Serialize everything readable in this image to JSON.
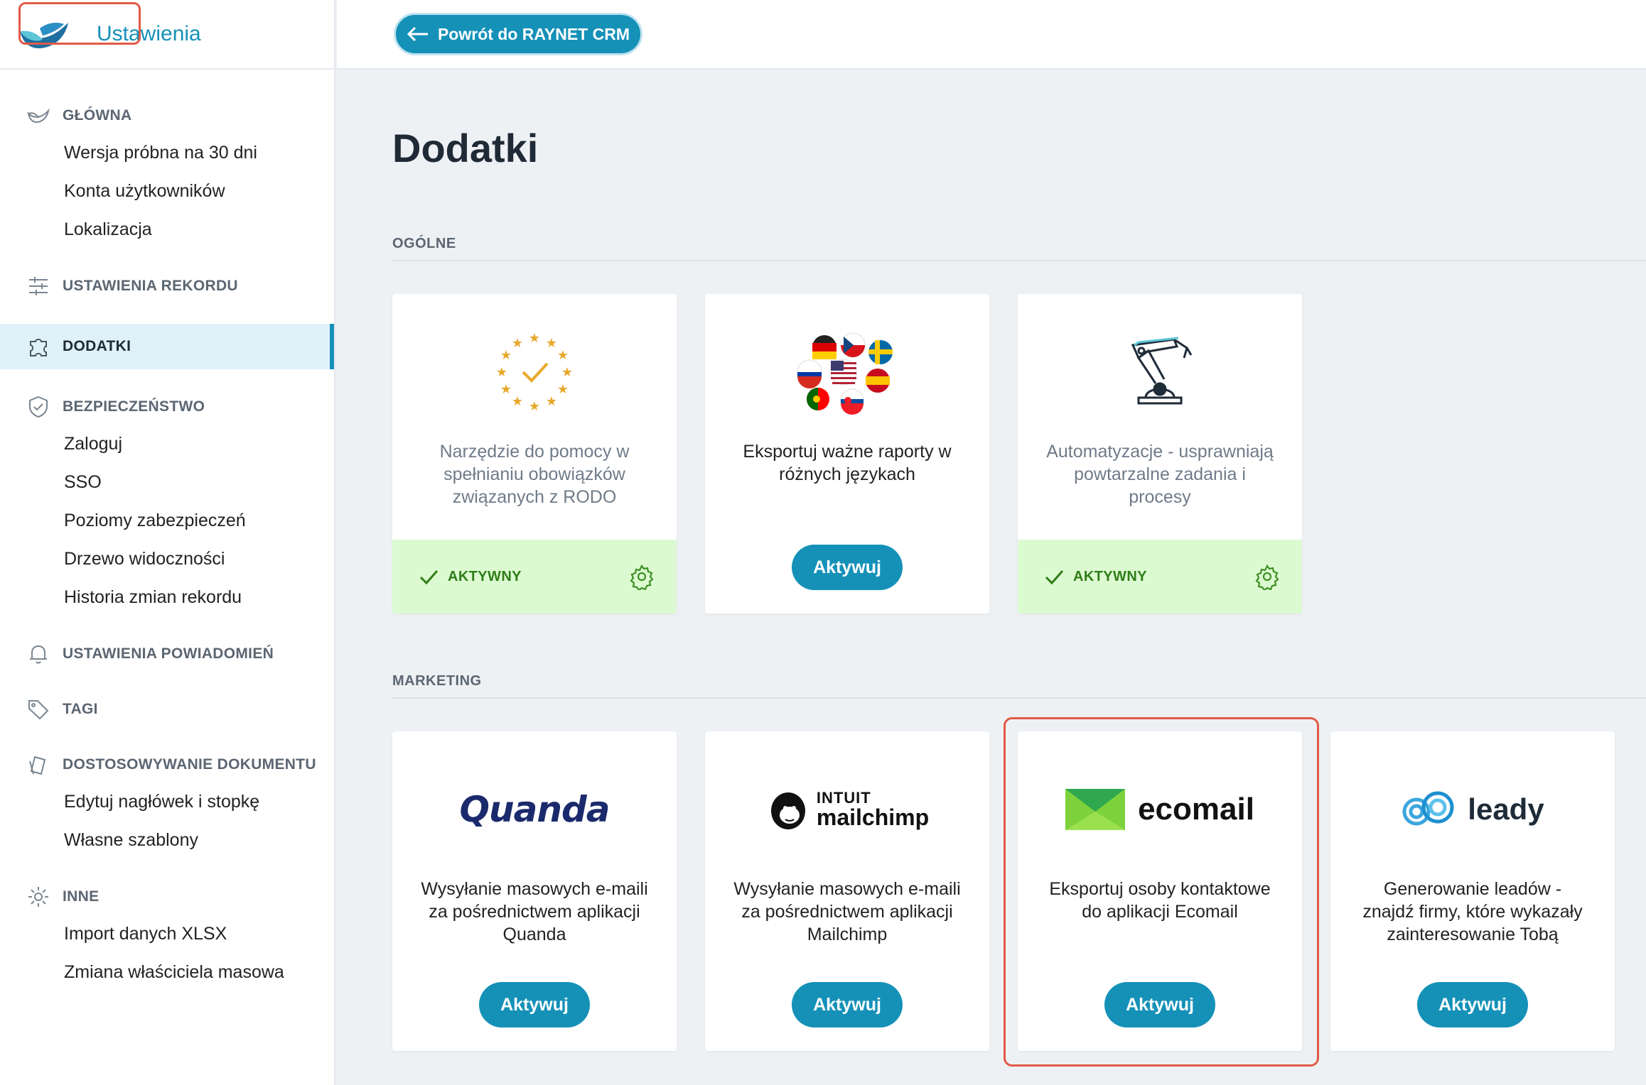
{
  "app": {
    "title": "Ustawienia"
  },
  "topbar": {
    "back_label": "Powrót do RAYNET CRM"
  },
  "page": {
    "title": "Dodatki"
  },
  "sidebar": {
    "sections": [
      {
        "label": "GŁÓWNA",
        "icon": "home-bird-icon",
        "items": [
          "Wersja próbna na 30 dni",
          "Konta użytkowników",
          "Lokalizacja"
        ]
      },
      {
        "label": "USTAWIENIA REKORDU",
        "icon": "sliders-icon",
        "items": []
      },
      {
        "label": "DODATKI",
        "icon": "puzzle-icon",
        "items": [],
        "active": true
      },
      {
        "label": "BEZPIECZEŃSTWO",
        "icon": "shield-icon",
        "items": [
          "Zaloguj",
          "SSO",
          "Poziomy zabezpieczeń",
          "Drzewo widoczności",
          "Historia zmian rekordu"
        ]
      },
      {
        "label": "USTAWIENIA POWIADOMIEŃ",
        "icon": "bell-icon",
        "items": []
      },
      {
        "label": "TAGI",
        "icon": "tag-icon",
        "items": []
      },
      {
        "label": "DOSTOSOWYWANIE DOKUMENTU",
        "icon": "documents-icon",
        "items": [
          "Edytuj nagłówek i stopkę",
          "Własne szablony"
        ]
      },
      {
        "label": "INNE",
        "icon": "gear-icon",
        "items": [
          "Import danych XLSX",
          "Zmiana właściciela masowa"
        ]
      }
    ]
  },
  "groups": {
    "general": {
      "label": "OGÓLNE",
      "cards": [
        {
          "icon": "eu-stars-check-icon",
          "description": "Narzędzie do pomocy w spełnianiu obowiązków związanych z RODO",
          "status": "AKTYWNY"
        },
        {
          "icon": "language-flags-icon",
          "description": "Eksportuj ważne raporty w różnych językach",
          "button": "Aktywuj"
        },
        {
          "icon": "robot-arm-icon",
          "description": "Automatyzacje - usprawniają powtarzalne zadania i procesy",
          "status": "AKTYWNY"
        }
      ]
    },
    "marketing": {
      "label": "MARKETING",
      "cards": [
        {
          "logo": "Quanda",
          "description": "Wysyłanie masowych e-maili za pośrednictwem aplikacji Quanda",
          "button": "Aktywuj"
        },
        {
          "logo_top": "INTUIT",
          "logo": "mailchimp",
          "description": "Wysyłanie masowych e-maili za pośrednictwem aplikacji Mailchimp",
          "button": "Aktywuj"
        },
        {
          "logo": "ecomail",
          "description": "Eksportuj osoby kontaktowe do aplikacji Ecomail",
          "button": "Aktywuj"
        },
        {
          "logo": "leady",
          "description": "Generowanie leadów - znajdź firmy, które wykazały zainteresowanie Tobą",
          "button": "Aktywuj"
        }
      ]
    }
  },
  "colors": {
    "accent": "#1591b8",
    "active_bg": "#dcfad1",
    "active_text": "#2f7d18",
    "highlight": "#e05a46"
  }
}
